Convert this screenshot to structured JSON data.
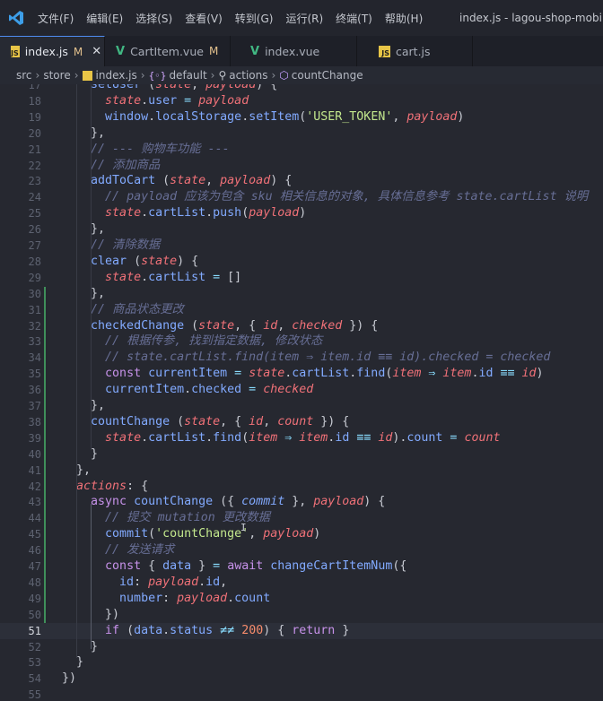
{
  "titlebar": {
    "menus": [
      "文件(F)",
      "编辑(E)",
      "选择(S)",
      "查看(V)",
      "转到(G)",
      "运行(R)",
      "终端(T)",
      "帮助(H)"
    ],
    "window_title": "index.js - lagou-shop-mobile - V"
  },
  "tabs": [
    {
      "label": "index.js",
      "type": "js",
      "modified": "M",
      "active": true,
      "close": "✕"
    },
    {
      "label": "CartItem.vue",
      "type": "vue",
      "modified": "M",
      "active": false
    },
    {
      "label": "index.vue",
      "type": "vue",
      "modified": "",
      "active": false
    },
    {
      "label": "cart.js",
      "type": "js",
      "modified": "",
      "active": false
    }
  ],
  "breadcrumb": [
    "src",
    "store",
    "index.js",
    "default",
    "actions",
    "countChange"
  ],
  "editor": {
    "current_line": 51,
    "lines": [
      {
        "n": 17,
        "segs": [
          [
            "pun",
            "    "
          ],
          [
            "fn",
            "setUser"
          ],
          [
            "pun",
            " ("
          ],
          [
            "param",
            "state"
          ],
          [
            "pun",
            ", "
          ],
          [
            "param",
            "payload"
          ],
          [
            "pun",
            ") {"
          ]
        ]
      },
      {
        "n": 18,
        "segs": [
          [
            "pun",
            "      "
          ],
          [
            "param",
            "state"
          ],
          [
            "pun",
            "."
          ],
          [
            "prop",
            "user"
          ],
          [
            "op",
            " = "
          ],
          [
            "param",
            "payload"
          ]
        ]
      },
      {
        "n": 19,
        "segs": [
          [
            "pun",
            "      "
          ],
          [
            "prop",
            "window"
          ],
          [
            "pun",
            "."
          ],
          [
            "prop",
            "localStorage"
          ],
          [
            "pun",
            "."
          ],
          [
            "fn",
            "setItem"
          ],
          [
            "pun",
            "("
          ],
          [
            "str",
            "'USER_TOKEN'"
          ],
          [
            "pun",
            ", "
          ],
          [
            "param",
            "payload"
          ],
          [
            "pun",
            ")"
          ]
        ]
      },
      {
        "n": 20,
        "segs": [
          [
            "pun",
            "    },"
          ]
        ]
      },
      {
        "n": 21,
        "segs": [
          [
            "pun",
            "    "
          ],
          [
            "cm",
            "// --- 购物车功能 ---"
          ]
        ]
      },
      {
        "n": 22,
        "segs": [
          [
            "pun",
            "    "
          ],
          [
            "cm",
            "// 添加商品"
          ]
        ]
      },
      {
        "n": 23,
        "segs": [
          [
            "pun",
            "    "
          ],
          [
            "fn",
            "addToCart"
          ],
          [
            "pun",
            " ("
          ],
          [
            "param",
            "state"
          ],
          [
            "pun",
            ", "
          ],
          [
            "param",
            "payload"
          ],
          [
            "pun",
            ") {"
          ]
        ]
      },
      {
        "n": 24,
        "segs": [
          [
            "pun",
            "      "
          ],
          [
            "cm",
            "// payload 应该为包含 sku 相关信息的对象, 具体信息参考 state.cartList 说明"
          ]
        ]
      },
      {
        "n": 25,
        "segs": [
          [
            "pun",
            "      "
          ],
          [
            "param",
            "state"
          ],
          [
            "pun",
            "."
          ],
          [
            "prop",
            "cartList"
          ],
          [
            "pun",
            "."
          ],
          [
            "fn",
            "push"
          ],
          [
            "pun",
            "("
          ],
          [
            "param",
            "payload"
          ],
          [
            "pun",
            ")"
          ]
        ]
      },
      {
        "n": 26,
        "segs": [
          [
            "pun",
            "    },"
          ]
        ]
      },
      {
        "n": 27,
        "segs": [
          [
            "pun",
            "    "
          ],
          [
            "cm",
            "// 清除数据"
          ]
        ]
      },
      {
        "n": 28,
        "segs": [
          [
            "pun",
            "    "
          ],
          [
            "fn",
            "clear"
          ],
          [
            "pun",
            " ("
          ],
          [
            "param",
            "state"
          ],
          [
            "pun",
            ") {"
          ]
        ]
      },
      {
        "n": 29,
        "segs": [
          [
            "pun",
            "      "
          ],
          [
            "param",
            "state"
          ],
          [
            "pun",
            "."
          ],
          [
            "prop",
            "cartList"
          ],
          [
            "op",
            " = "
          ],
          [
            "pun",
            "[]"
          ]
        ]
      },
      {
        "n": 30,
        "segs": [
          [
            "pun",
            "    },"
          ]
        ]
      },
      {
        "n": 31,
        "segs": [
          [
            "pun",
            "    "
          ],
          [
            "cm",
            "// 商品状态更改"
          ]
        ]
      },
      {
        "n": 32,
        "segs": [
          [
            "pun",
            "    "
          ],
          [
            "fn",
            "checkedChange"
          ],
          [
            "pun",
            " ("
          ],
          [
            "param",
            "state"
          ],
          [
            "pun",
            ", { "
          ],
          [
            "param",
            "id"
          ],
          [
            "pun",
            ", "
          ],
          [
            "param",
            "checked"
          ],
          [
            "pun",
            " }) {"
          ]
        ]
      },
      {
        "n": 33,
        "segs": [
          [
            "pun",
            "      "
          ],
          [
            "cm",
            "// 根据传参, 找到指定数据, 修改状态"
          ]
        ]
      },
      {
        "n": 34,
        "segs": [
          [
            "pun",
            "      "
          ],
          [
            "cm",
            "// state.cartList.find(item ⇒ item.id ≡≡ id).checked = checked"
          ]
        ]
      },
      {
        "n": 35,
        "segs": [
          [
            "pun",
            "      "
          ],
          [
            "kw",
            "const "
          ],
          [
            "prop",
            "currentItem"
          ],
          [
            "op",
            " = "
          ],
          [
            "param",
            "state"
          ],
          [
            "pun",
            "."
          ],
          [
            "prop",
            "cartList"
          ],
          [
            "pun",
            "."
          ],
          [
            "fn",
            "find"
          ],
          [
            "pun",
            "("
          ],
          [
            "param",
            "item"
          ],
          [
            "op",
            " ⇒ "
          ],
          [
            "param",
            "item"
          ],
          [
            "pun",
            "."
          ],
          [
            "prop",
            "id"
          ],
          [
            "op",
            " ≡≡ "
          ],
          [
            "param",
            "id"
          ],
          [
            "pun",
            ")"
          ]
        ]
      },
      {
        "n": 36,
        "segs": [
          [
            "pun",
            "      "
          ],
          [
            "prop",
            "currentItem"
          ],
          [
            "pun",
            "."
          ],
          [
            "prop",
            "checked"
          ],
          [
            "op",
            " = "
          ],
          [
            "param",
            "checked"
          ]
        ]
      },
      {
        "n": 37,
        "segs": [
          [
            "pun",
            "    },"
          ]
        ]
      },
      {
        "n": 38,
        "segs": [
          [
            "pun",
            "    "
          ],
          [
            "fn",
            "countChange"
          ],
          [
            "pun",
            " ("
          ],
          [
            "param",
            "state"
          ],
          [
            "pun",
            ", { "
          ],
          [
            "param",
            "id"
          ],
          [
            "pun",
            ", "
          ],
          [
            "param",
            "count"
          ],
          [
            "pun",
            " }) {"
          ]
        ]
      },
      {
        "n": 39,
        "segs": [
          [
            "pun",
            "      "
          ],
          [
            "param",
            "state"
          ],
          [
            "pun",
            "."
          ],
          [
            "prop",
            "cartList"
          ],
          [
            "pun",
            "."
          ],
          [
            "fn",
            "find"
          ],
          [
            "pun",
            "("
          ],
          [
            "param",
            "item"
          ],
          [
            "op",
            " ⇒ "
          ],
          [
            "param",
            "item"
          ],
          [
            "pun",
            "."
          ],
          [
            "prop",
            "id"
          ],
          [
            "op",
            " ≡≡ "
          ],
          [
            "param",
            "id"
          ],
          [
            "pun",
            ")."
          ],
          [
            "prop",
            "count"
          ],
          [
            "op",
            " = "
          ],
          [
            "param",
            "count"
          ]
        ]
      },
      {
        "n": 40,
        "segs": [
          [
            "pun",
            "    }"
          ]
        ]
      },
      {
        "n": 41,
        "segs": [
          [
            "pun",
            "  },"
          ]
        ]
      },
      {
        "n": 42,
        "segs": [
          [
            "pun",
            "  "
          ],
          [
            "param",
            "actions"
          ],
          [
            "pun",
            ": {"
          ]
        ]
      },
      {
        "n": 43,
        "segs": [
          [
            "pun",
            "    "
          ],
          [
            "kw",
            "async "
          ],
          [
            "fn",
            "countChange"
          ],
          [
            "pun",
            " ({ "
          ],
          [
            "bi",
            "commit"
          ],
          [
            "pun",
            " }, "
          ],
          [
            "param",
            "payload"
          ],
          [
            "pun",
            ") {"
          ]
        ]
      },
      {
        "n": 44,
        "segs": [
          [
            "pun",
            "      "
          ],
          [
            "cm",
            "// 提交 mutation 更改数据"
          ]
        ]
      },
      {
        "n": 45,
        "segs": [
          [
            "pun",
            "      "
          ],
          [
            "fn",
            "commit"
          ],
          [
            "pun",
            "("
          ],
          [
            "str",
            "'countChange'"
          ],
          [
            "pun",
            ", "
          ],
          [
            "param",
            "payload"
          ],
          [
            "pun",
            ")"
          ]
        ]
      },
      {
        "n": 46,
        "segs": [
          [
            "pun",
            "      "
          ],
          [
            "cm",
            "// 发送请求"
          ]
        ]
      },
      {
        "n": 47,
        "segs": [
          [
            "pun",
            "      "
          ],
          [
            "kw",
            "const "
          ],
          [
            "pun",
            "{ "
          ],
          [
            "prop",
            "data"
          ],
          [
            "pun",
            " } "
          ],
          [
            "op",
            "= "
          ],
          [
            "kw",
            "await "
          ],
          [
            "fn",
            "changeCartItemNum"
          ],
          [
            "pun",
            "({"
          ]
        ]
      },
      {
        "n": 48,
        "segs": [
          [
            "pun",
            "        "
          ],
          [
            "prop",
            "id"
          ],
          [
            "pun",
            ": "
          ],
          [
            "param",
            "payload"
          ],
          [
            "pun",
            "."
          ],
          [
            "prop",
            "id"
          ],
          [
            "pun",
            ","
          ]
        ]
      },
      {
        "n": 49,
        "segs": [
          [
            "pun",
            "        "
          ],
          [
            "prop",
            "number"
          ],
          [
            "pun",
            ": "
          ],
          [
            "param",
            "payload"
          ],
          [
            "pun",
            "."
          ],
          [
            "prop",
            "count"
          ]
        ]
      },
      {
        "n": 50,
        "segs": [
          [
            "pun",
            "      })"
          ]
        ]
      },
      {
        "n": 51,
        "segs": [
          [
            "pun",
            "      "
          ],
          [
            "kw",
            "if"
          ],
          [
            "pun",
            " ("
          ],
          [
            "prop",
            "data"
          ],
          [
            "pun",
            "."
          ],
          [
            "prop",
            "status"
          ],
          [
            "op",
            " ≠≠ "
          ],
          [
            "num",
            "200"
          ],
          [
            "pun",
            ") { "
          ],
          [
            "kw",
            "return"
          ],
          [
            "pun",
            " }"
          ]
        ]
      },
      {
        "n": 52,
        "segs": [
          [
            "pun",
            "    }"
          ]
        ]
      },
      {
        "n": 53,
        "segs": [
          [
            "pun",
            "  }"
          ]
        ]
      },
      {
        "n": 54,
        "segs": [
          [
            "pun",
            "})"
          ]
        ]
      },
      {
        "n": 55,
        "segs": []
      }
    ]
  }
}
